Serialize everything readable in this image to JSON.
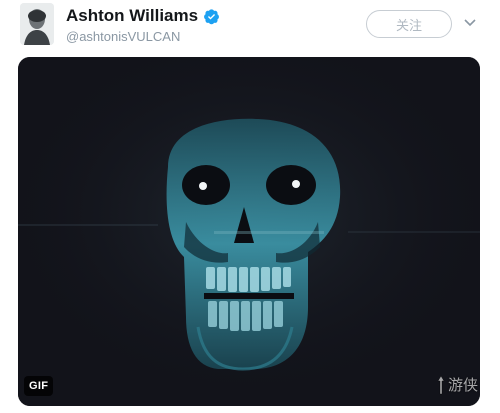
{
  "tweet": {
    "display_name": "Ashton Williams",
    "handle": "@ashtonisVULCAN",
    "follow_label": "关注",
    "verified": true
  },
  "media": {
    "badge": "GIF",
    "description_icon": "skull-gif"
  },
  "watermark": {
    "text": "游侠"
  },
  "colors": {
    "verified_blue": "#1da1f2",
    "media_bg": "#12131a",
    "skull_glow": "#4fb3c9"
  }
}
